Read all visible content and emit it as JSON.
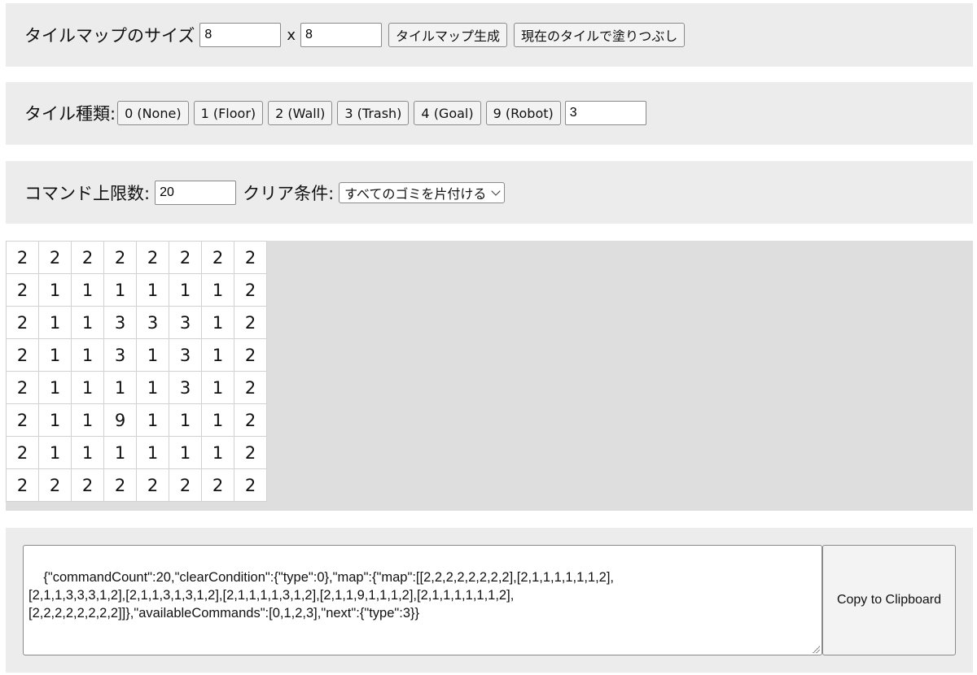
{
  "size_panel": {
    "label": "タイルマップのサイズ",
    "width_value": "8",
    "times": "x",
    "height_value": "8",
    "generate_button": "タイルマップ生成",
    "fill_button": "現在のタイルで塗りつぶし"
  },
  "tile_panel": {
    "label": "タイル種類:",
    "buttons": [
      "0 (None)",
      "1 (Floor)",
      "2 (Wall)",
      "3 (Trash)",
      "4 (Goal)",
      "9 (Robot)"
    ],
    "current_value": "3"
  },
  "command_panel": {
    "limit_label": "コマンド上限数:",
    "limit_value": "20",
    "clear_label": "クリア条件:",
    "clear_selected": "すべてのゴミを片付ける"
  },
  "grid": [
    [
      2,
      2,
      2,
      2,
      2,
      2,
      2,
      2
    ],
    [
      2,
      1,
      1,
      1,
      1,
      1,
      1,
      2
    ],
    [
      2,
      1,
      1,
      3,
      3,
      3,
      1,
      2
    ],
    [
      2,
      1,
      1,
      3,
      1,
      3,
      1,
      2
    ],
    [
      2,
      1,
      1,
      1,
      1,
      3,
      1,
      2
    ],
    [
      2,
      1,
      1,
      9,
      1,
      1,
      1,
      2
    ],
    [
      2,
      1,
      1,
      1,
      1,
      1,
      1,
      2
    ],
    [
      2,
      2,
      2,
      2,
      2,
      2,
      2,
      2
    ]
  ],
  "json_panel": {
    "json_text": "{\"commandCount\":20,\"clearCondition\":{\"type\":0},\"map\":{\"map\":[[2,2,2,2,2,2,2,2],[2,1,1,1,1,1,1,2],\n[2,1,1,3,3,3,1,2],[2,1,1,3,1,3,1,2],[2,1,1,1,1,3,1,2],[2,1,1,9,1,1,1,2],[2,1,1,1,1,1,1,2],\n[2,2,2,2,2,2,2,2]]},\"availableCommands\":[0,1,2,3],\"next\":{\"type\":3}}",
    "copy_button": "Copy to Clipboard"
  }
}
